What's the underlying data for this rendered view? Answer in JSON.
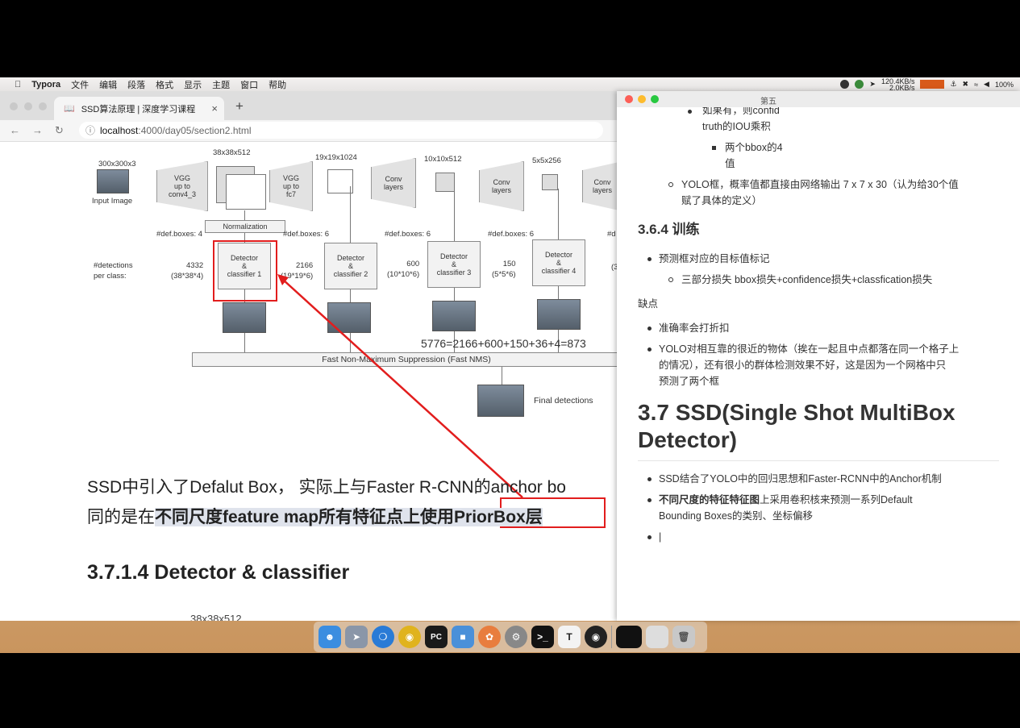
{
  "menubar": {
    "apple": "",
    "app_name": "Typora",
    "menus": [
      "文件",
      "编辑",
      "段落",
      "格式",
      "显示",
      "主题",
      "窗口",
      "帮助"
    ],
    "net_up": "120.4KB/s",
    "net_down": "2.0KB/s",
    "battery": "100%"
  },
  "browser": {
    "tab_title": "SSD算法原理 | 深度学习课程",
    "url_host": "localhost",
    "url_path": ":4000/day05/section2.html",
    "diagram": {
      "input_size": "300x300x3",
      "input_label": "Input Image",
      "vgg1": "VGG\nup to\nconv4_3",
      "vgg2": "VGG\nup to\nfc7",
      "conv": "Conv\nlayers",
      "sizes": [
        "38x38x512",
        "19x19x1024",
        "10x10x512",
        "5x5x256"
      ],
      "normalization": "Normalization",
      "def_boxes": [
        "#def.boxes: 4",
        "#def.boxes: 6",
        "#def.boxes: 6",
        "#def.boxes: 6",
        "#d"
      ],
      "detections_label": "#detections\nper class:",
      "counts": [
        "4332\n(38*38*4)",
        "2166\n(19*19*6)",
        "600\n(10*10*6)",
        "150\n(5*5*6)",
        "(3"
      ],
      "detectors": [
        "Detector\n&\nclassifier 1",
        "Detector\n&\nclassifier 2",
        "Detector\n&\nclassifier 3",
        "Detector\n&\nclassifier 4"
      ],
      "sum": "5776=2166+600+150+36+4=873",
      "nms": "Fast Non-Maximum Suppression (Fast NMS)",
      "final": "Final detections"
    },
    "para_line1": "SSD中引入了Defalut Box， 实际上与Faster R-CNN的anchor bo",
    "para_line2_plain": "同的是在",
    "para_line2_hl": "不同尺度feature map所有特征点上使用",
    "para_line2_box": "PriorBox层",
    "heading": "3.7.1.4 Detector & classifier",
    "cut_text": "38x38x512"
  },
  "typora": {
    "title": "第五",
    "items": {
      "l1": "如果有，则confid",
      "l1b": "truth的IOU乘积",
      "l2": "两个bbox的4",
      "l2b": "值",
      "l3": "YOLO框，概率值都直接由网络输出 7 x 7 x 30（认为给30个值",
      "l3b": "赋了具体的定义）",
      "h364": "3.6.4 训练",
      "t1": "预测框对应的目标值标记",
      "t2": "三部分损失 bbox损失+confidence损失+classfication损失",
      "que": "缺点",
      "q1": "准确率会打折扣",
      "q2a": "YOLO对相互靠的很近的物体（挨在一起且中点都落在同一个格子上",
      "q2b": "的情况），还有很小的群体检测效果不好，这是因为一个网格中只",
      "q2c": "预测了两个框",
      "h37a": "3.7 SSD(Single Shot MultiBox",
      "h37b": "Detector)",
      "s1": "SSD结合了YOLO中的回归思想和Faster-RCNN中的Anchor机制",
      "s2a": "不同尺度的特征特征图",
      "s2b": "上采用卷积核来预测一系列Default",
      "s2c": "Bounding Boxes的类别、坐标偏移",
      "cursor": "|"
    }
  },
  "dock": {
    "t_label": "T",
    "pc_label": "PC"
  },
  "colors": {
    "annotation_red": "#e21d1d",
    "highlight": "#dfe3ec"
  }
}
